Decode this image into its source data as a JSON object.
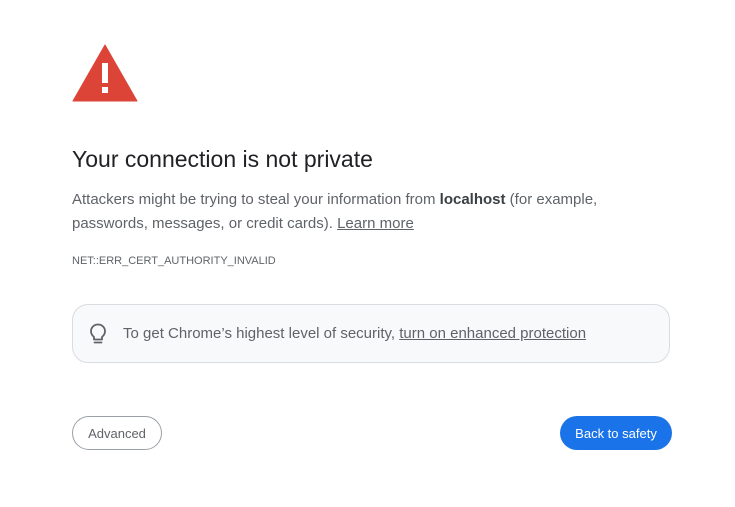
{
  "interstitial": {
    "icon": "warning-triangle-icon",
    "heading": "Your connection is not private",
    "message_before": "Attackers might be trying to steal your information from ",
    "host": "localhost",
    "message_after": " (for example, passwords, messages, or credit cards). ",
    "learn_more_link": "Learn more",
    "error_code": "NET::ERR_CERT_AUTHORITY_INVALID"
  },
  "enhanced_protection": {
    "icon": "lightbulb-icon",
    "text_before": "To get Chrome’s highest level of security, ",
    "link_text": "turn on enhanced protection"
  },
  "buttons": {
    "advanced_label": "Advanced",
    "back_to_safety_label": "Back to safety"
  },
  "colors": {
    "warning_red": "#db4437",
    "primary_blue": "#1a73e8",
    "text_gray": "#5f6368",
    "heading_text": "#202124",
    "box_background": "#f8f9fa"
  }
}
